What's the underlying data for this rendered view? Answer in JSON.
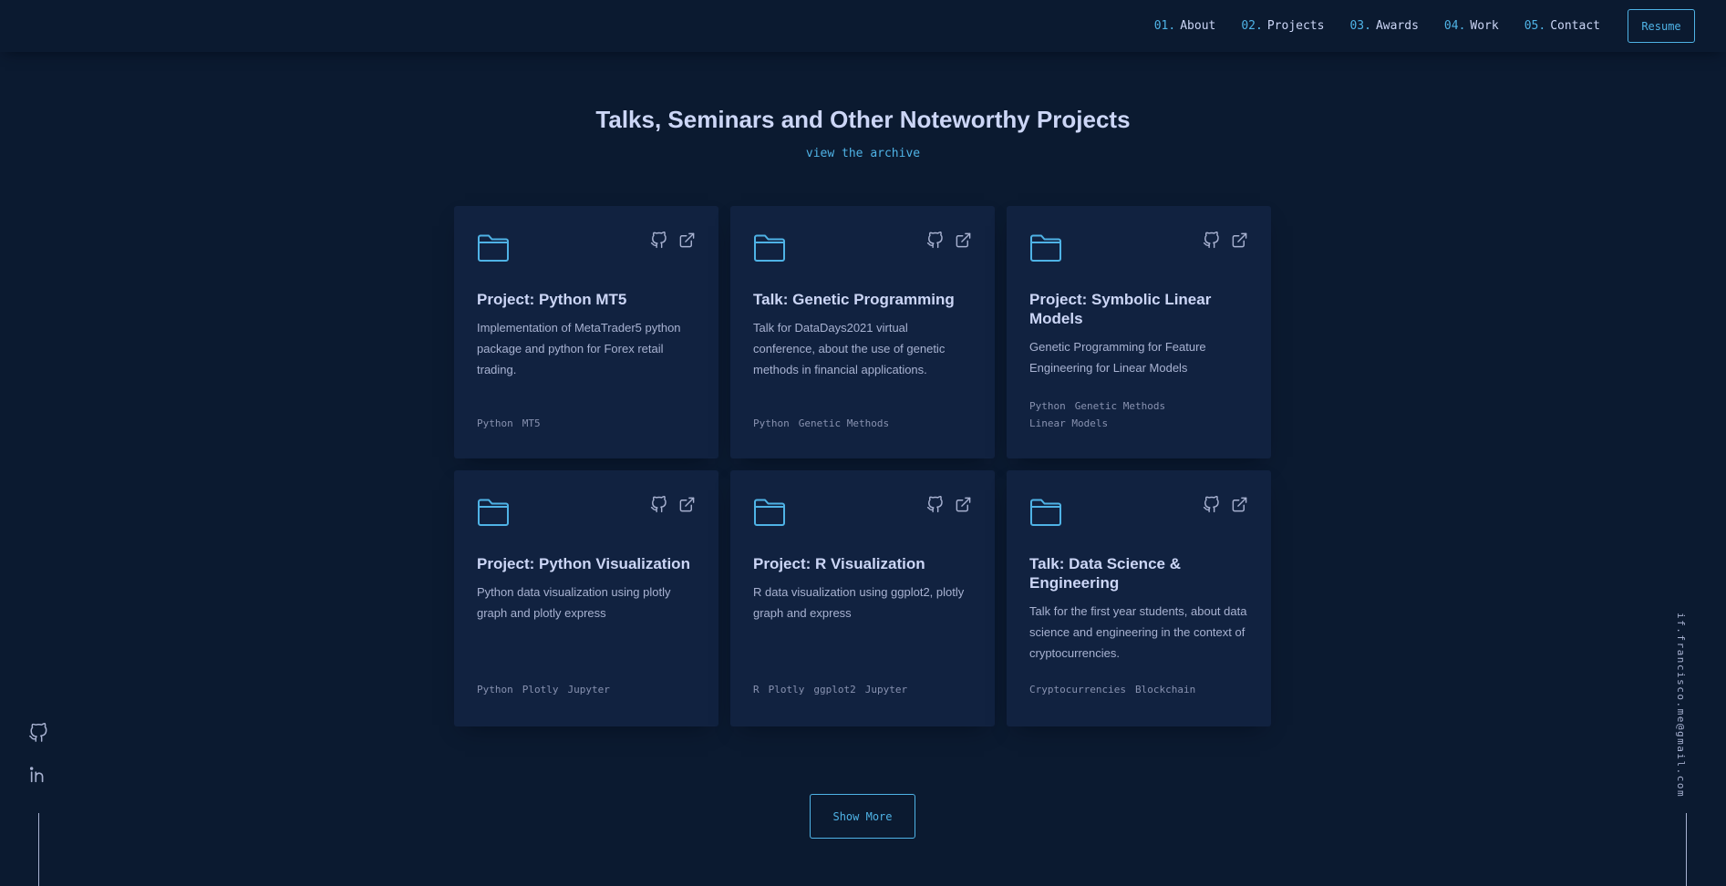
{
  "nav": {
    "items": [
      {
        "num": "01.",
        "label": "About"
      },
      {
        "num": "02.",
        "label": "Projects"
      },
      {
        "num": "03.",
        "label": "Awards"
      },
      {
        "num": "04.",
        "label": "Work"
      },
      {
        "num": "05.",
        "label": "Contact"
      }
    ],
    "resume_label": "Resume"
  },
  "section": {
    "title": "Talks, Seminars and Other Noteworthy Projects",
    "archive_link": "view the archive"
  },
  "projects": [
    {
      "title": "Project: Python MT5",
      "description": "Implementation of MetaTrader5 python package and python for Forex retail trading.",
      "tags": [
        "Python",
        "MT5"
      ]
    },
    {
      "title": "Talk: Genetic Programming",
      "description": "Talk for DataDays2021 virtual conference, about the use of genetic methods in financial applications.",
      "tags": [
        "Python",
        "Genetic Methods"
      ]
    },
    {
      "title": "Project: Symbolic Linear Models",
      "description": "Genetic Programming for Feature Engineering for Linear Models",
      "tags": [
        "Python",
        "Genetic Methods",
        "Linear Models"
      ]
    },
    {
      "title": "Project: Python Visualization",
      "description": "Python data visualization using plotly graph and plotly express",
      "tags": [
        "Python",
        "Plotly",
        "Jupyter"
      ]
    },
    {
      "title": "Project: R Visualization",
      "description": "R data visualization using ggplot2, plotly graph and express",
      "tags": [
        "R",
        "Plotly",
        "ggplot2",
        "Jupyter"
      ]
    },
    {
      "title": "Talk: Data Science & Engineering",
      "description": "Talk for the first year students, about data science and engineering in the context of cryptocurrencies.",
      "tags": [
        "Cryptocurrencies",
        "Blockchain"
      ]
    }
  ],
  "show_more_label": "Show More",
  "email": "if.francisco.me@gmail.com",
  "icons": {
    "folder": "folder-icon",
    "github": "github-icon",
    "external": "external-link-icon",
    "linkedin": "linkedin-icon"
  },
  "colors": {
    "background": "#0b1a30",
    "card": "#112240",
    "accent": "#4fb3e6",
    "heading": "#ccd6f6",
    "text": "#8892b0"
  }
}
